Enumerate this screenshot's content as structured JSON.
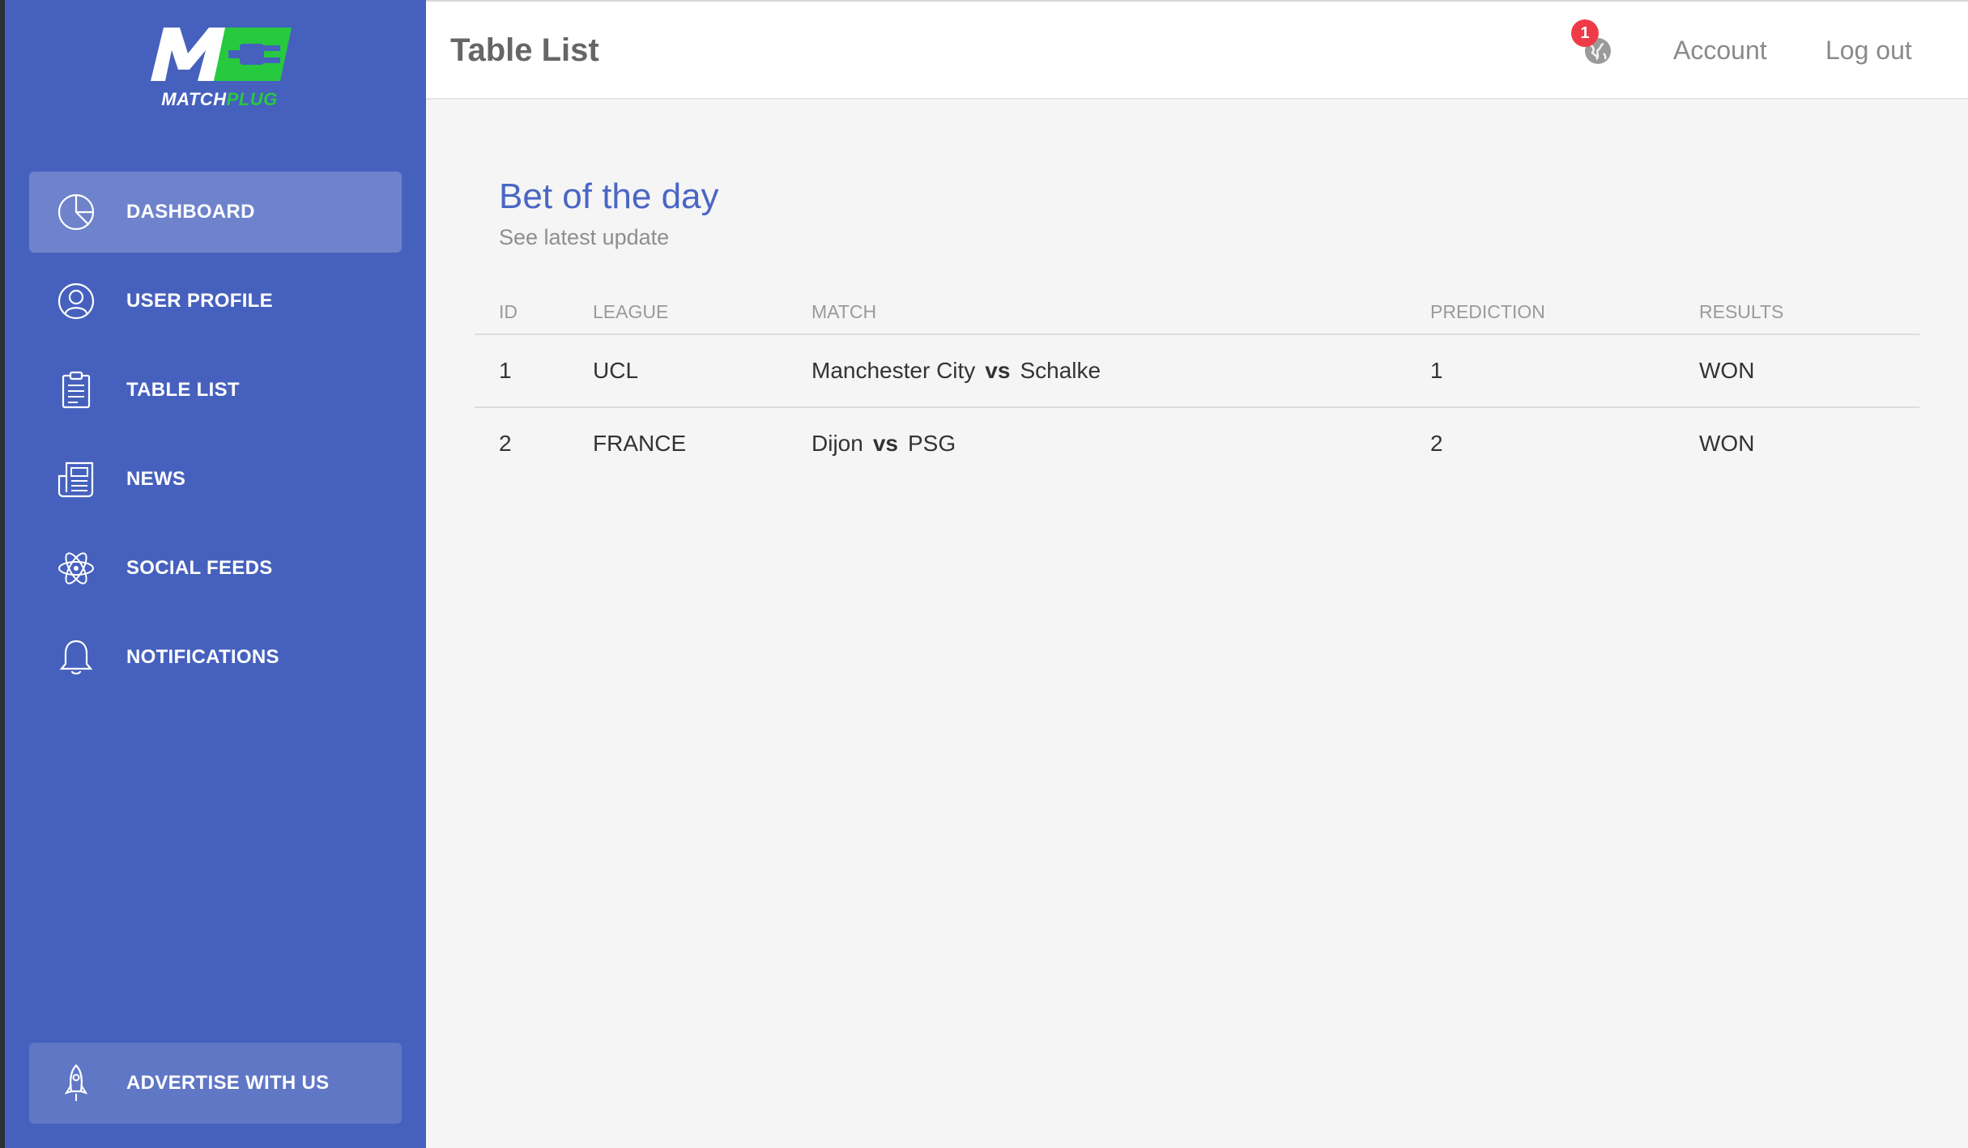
{
  "brand": {
    "logo_word_1": "MATCH",
    "logo_word_2": "PLUG",
    "logo_mark": "MC",
    "colors": {
      "sidebar": "#4661bd",
      "accent_green": "#27c93f",
      "badge_red": "#ef3a48"
    }
  },
  "sidebar": {
    "items": [
      {
        "label": "DASHBOARD",
        "icon": "pie-chart-icon",
        "active": true
      },
      {
        "label": "USER PROFILE",
        "icon": "user-icon",
        "active": false
      },
      {
        "label": "TABLE LIST",
        "icon": "clipboard-icon",
        "active": false
      },
      {
        "label": "NEWS",
        "icon": "newspaper-icon",
        "active": false
      },
      {
        "label": "SOCIAL FEEDS",
        "icon": "atom-icon",
        "active": false
      },
      {
        "label": "NOTIFICATIONS",
        "icon": "bell-icon",
        "active": false
      }
    ],
    "footer": {
      "label": "ADVERTISE WITH US",
      "icon": "rocket-icon"
    }
  },
  "header": {
    "title": "Table List",
    "notification_count": "1",
    "account_label": "Account",
    "logout_label": "Log out"
  },
  "card": {
    "title": "Bet of the day",
    "subtitle": "See latest update"
  },
  "table": {
    "columns": [
      "ID",
      "LEAGUE",
      "MATCH",
      "PREDICTION",
      "RESULTS"
    ],
    "rows": [
      {
        "id": "1",
        "league": "UCL",
        "home": "Manchester City",
        "vs": "vs",
        "away": "Schalke",
        "prediction": "1",
        "result": "WON"
      },
      {
        "id": "2",
        "league": "FRANCE",
        "home": "Dijon",
        "vs": "vs",
        "away": "PSG",
        "prediction": "2",
        "result": "WON"
      }
    ]
  }
}
